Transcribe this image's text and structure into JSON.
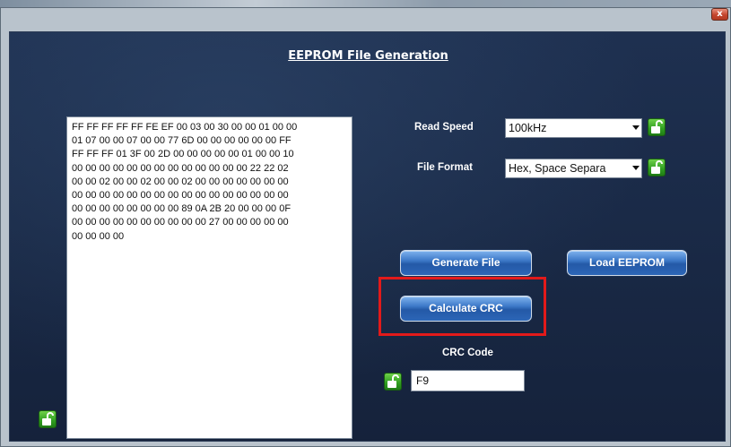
{
  "window": {
    "close_glyph": "x",
    "title": "EEPROM File Generation"
  },
  "hex_content": "FF FF FF FF FF FE EF 00 03 00 30 00 00 01 00 00\n01 07 00 00 07 00 00 77 6D 00 00 00 00 00 00 FF\nFF FF FF 01 3F 00 2D 00 00 00 00 00 01 00 00 10\n00 00 00 00 00 00 00 00 00 00 00 00 00 22 22 02\n00 00 02 00 00 02 00 00 02 00 00 00 00 00 00 00\n00 00 00 00 00 00 00 00 00 00 00 00 00 00 00 00\n00 00 00 00 00 00 00 00 89 0A 2B 20 00 00 00 0F\n00 00 00 00 00 00 00 00 00 00 27 00 00 00 00 00\n00 00 00 00",
  "read_speed": {
    "label": "Read Speed",
    "value": "100kHz"
  },
  "file_format": {
    "label": "File Format",
    "value": "Hex, Space Separa"
  },
  "buttons": {
    "generate_file": "Generate File",
    "load_eeprom": "Load EEPROM",
    "calculate_crc": "Calculate CRC"
  },
  "crc": {
    "label": "CRC Code",
    "value": "F9"
  },
  "colors": {
    "panel": "#1a2a47",
    "button": "#2c66b7",
    "lock": "#2f9e20",
    "highlight": "#e21a1a"
  },
  "icons": {
    "lock": "unlocked-padlock-icon",
    "close": "close-icon"
  }
}
